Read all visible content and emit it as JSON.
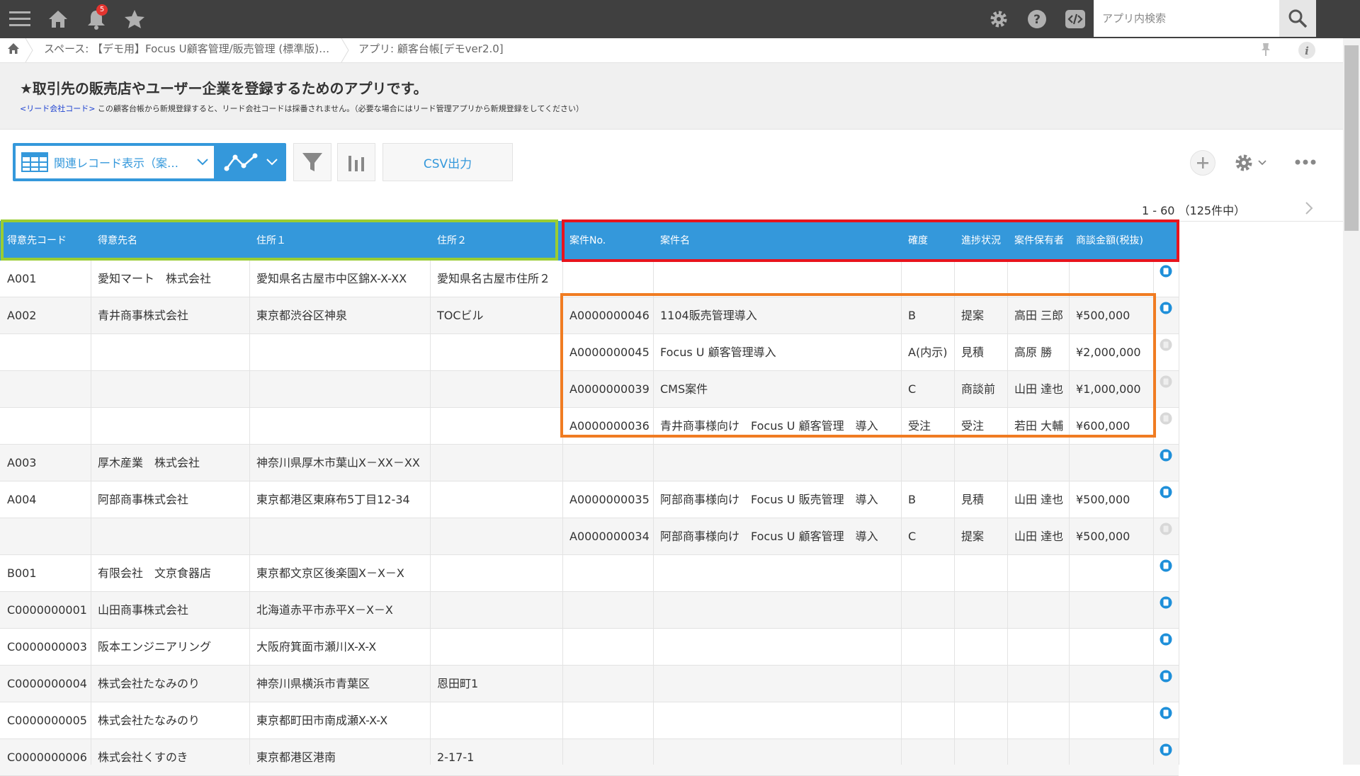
{
  "topbar": {
    "notification_count": "5",
    "search_placeholder": "アプリ内検索",
    "icons": [
      "menu-icon",
      "home-icon",
      "bell-icon",
      "star-icon",
      "gear-icon",
      "help-icon",
      "code-icon",
      "search-icon"
    ]
  },
  "breadcrumb": {
    "space": "スペース: 【デモ用】Focus U顧客管理/販売管理 (標準版)…",
    "app": "アプリ: 顧客台帳[デモver2.0]"
  },
  "description": {
    "title": "★取引先の販売店やユーザー企業を登録するためのアプリです。",
    "note_lead": "<リード会社コード>",
    "note_text": " この顧客台帳から新規登録すると、リード会社コードは採番されません。（必要な場合にはリード管理アプリから新規登録をしてください）"
  },
  "toolbar": {
    "view_label": "関連レコード表示（案…",
    "csv_label": "CSV出力"
  },
  "pager": {
    "text": "1 - 60 （125件中）"
  },
  "colors": {
    "accent": "#3498db",
    "green_box": "#9acd32",
    "red_box": "#e8141d",
    "orange_box": "#f07c22"
  },
  "table": {
    "headers": [
      "得意先コード",
      "得意先名",
      "住所１",
      "住所２",
      "案件No.",
      "案件名",
      "確度",
      "進捗状況",
      "案件保有者",
      "商談金額(税抜)"
    ],
    "rows": [
      [
        "A001",
        "愛知マート　株式会社",
        "愛知県名古屋市中区錦X-X-XX",
        "愛知県名古屋市住所２",
        "",
        "",
        "",
        "",
        "",
        ""
      ],
      [
        "A002",
        "青井商事株式会社",
        "東京都渋谷区神泉",
        "TOCビル",
        "A0000000046",
        "1104販売管理導入",
        "B",
        "提案",
        "高田 三郎",
        "¥500,000"
      ],
      [
        "",
        "",
        "",
        "",
        "A0000000045",
        "Focus U 顧客管理導入",
        "A(内示)",
        "見積",
        "高原 勝",
        "¥2,000,000"
      ],
      [
        "",
        "",
        "",
        "",
        "A0000000039",
        "CMS案件",
        "C",
        "商談前",
        "山田 達也",
        "¥1,000,000"
      ],
      [
        "",
        "",
        "",
        "",
        "A0000000036",
        "青井商事様向け　Focus U 顧客管理　導入",
        "受注",
        "受注",
        "若田 大輔",
        "¥600,000"
      ],
      [
        "A003",
        "厚木産業　株式会社",
        "神奈川県厚木市葉山X－XX－XX",
        "",
        "",
        "",
        "",
        "",
        "",
        ""
      ],
      [
        "A004",
        "阿部商事株式会社",
        "東京都港区東麻布5丁目12-34",
        "",
        "A0000000035",
        "阿部商事様向け　Focus U 販売管理　導入",
        "B",
        "見積",
        "山田 達也",
        "¥500,000"
      ],
      [
        "",
        "",
        "",
        "",
        "A0000000034",
        "阿部商事様向け　Focus U 顧客管理　導入",
        "C",
        "提案",
        "山田 達也",
        "¥500,000"
      ],
      [
        "B001",
        "有限会社　文京食器店",
        "東京都文京区後楽園X－X－X",
        "",
        "",
        "",
        "",
        "",
        "",
        ""
      ],
      [
        "C0000000001",
        "山田商事株式会社",
        "北海道赤平市赤平X－X－X",
        "",
        "",
        "",
        "",
        "",
        "",
        ""
      ],
      [
        "C0000000003",
        "阪本エンジニアリング",
        "大阪府箕面市瀬川X-X-X",
        "",
        "",
        "",
        "",
        "",
        "",
        ""
      ],
      [
        "C0000000004",
        "株式会社たなみのり",
        "神奈川県横浜市青葉区",
        "恩田町1",
        "",
        "",
        "",
        "",
        "",
        ""
      ],
      [
        "C0000000005",
        "株式会社たなみのり",
        "東京都町田市南成瀬X-X-X",
        "",
        "",
        "",
        "",
        "",
        "",
        ""
      ],
      [
        "C0000000006",
        "株式会社くすのき",
        "東京都港区港南",
        "2-17-1",
        "",
        "",
        "",
        "",
        "",
        ""
      ]
    ],
    "detail_icon_active": [
      true,
      true,
      false,
      false,
      false,
      true,
      true,
      false,
      true,
      true,
      true,
      true,
      true,
      true
    ]
  }
}
